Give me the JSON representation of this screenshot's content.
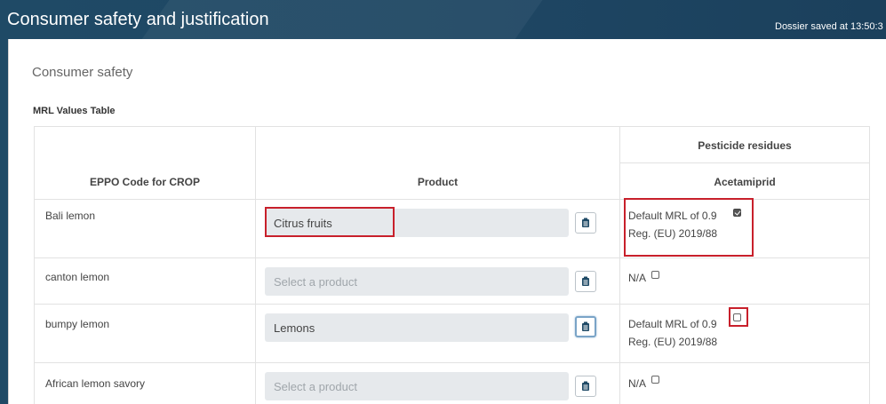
{
  "header": {
    "title": "Consumer safety and justification",
    "saved_status": "Dossier saved at 13:50:3"
  },
  "section_title": "Consumer safety",
  "table": {
    "title": "MRL Values Table",
    "col_crop": "EPPO Code for CROP",
    "col_product": "Product",
    "group_header": "Pesticide residues",
    "substance": "Acetamiprid",
    "rows": [
      {
        "crop": "Bali lemon",
        "product": "Citrus fruits",
        "product_placeholder": "",
        "residue_line1": "Default MRL of 0.9",
        "residue_line2": "Reg. (EU) 2019/88",
        "checked": true
      },
      {
        "crop": "canton lemon",
        "product": "",
        "product_placeholder": "Select a product",
        "residue_line1": "N/A",
        "residue_line2": "",
        "checked": false
      },
      {
        "crop": "bumpy lemon",
        "product": "Lemons",
        "product_placeholder": "",
        "residue_line1": "Default MRL of 0.9",
        "residue_line2": "Reg. (EU) 2019/88",
        "checked": false
      },
      {
        "crop": "African lemon savory",
        "product": "",
        "product_placeholder": "Select a product",
        "residue_line1": "N/A",
        "residue_line2": "",
        "checked": false
      }
    ]
  },
  "icons": {
    "product_button": "clipboard-icon"
  },
  "colors": {
    "header_bg": "#1f4a66",
    "highlight": "#c8202b",
    "select_bg": "#e6e9ec"
  }
}
